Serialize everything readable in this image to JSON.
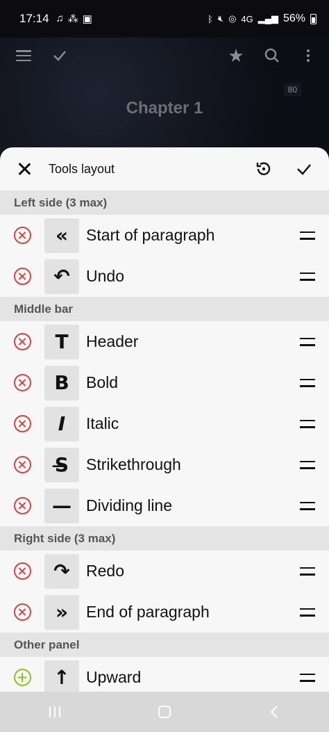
{
  "status_bar": {
    "time": "17:14",
    "network": "4G",
    "battery": "56%"
  },
  "app": {
    "counter": "80",
    "chapter_title": "Chapter 1"
  },
  "sheet": {
    "title": "Tools layout",
    "sections": [
      {
        "label": "Left side (3 max)",
        "items": [
          {
            "label": "Start of paragraph",
            "icon": "double-chevron-left-icon",
            "glyph": "«",
            "state": "remove"
          },
          {
            "label": "Undo",
            "icon": "undo-icon",
            "glyph": "↶",
            "state": "remove"
          }
        ]
      },
      {
        "label": "Middle bar",
        "items": [
          {
            "label": "Header",
            "icon": "header-icon",
            "glyph": "T",
            "state": "remove"
          },
          {
            "label": "Bold",
            "icon": "bold-icon",
            "glyph": "B",
            "state": "remove"
          },
          {
            "label": "Italic",
            "icon": "italic-icon",
            "glyph": "I",
            "state": "remove"
          },
          {
            "label": "Strikethrough",
            "icon": "strikethrough-icon",
            "glyph": "S̶",
            "state": "remove"
          },
          {
            "label": "Dividing line",
            "icon": "dividing-line-icon",
            "glyph": "—",
            "state": "remove"
          }
        ]
      },
      {
        "label": "Right side (3 max)",
        "items": [
          {
            "label": "Redo",
            "icon": "redo-icon",
            "glyph": "↷",
            "state": "remove"
          },
          {
            "label": "End of paragraph",
            "icon": "double-chevron-right-icon",
            "glyph": "»",
            "state": "remove"
          }
        ]
      },
      {
        "label": "Other panel",
        "items": [
          {
            "label": "Upward",
            "icon": "arrow-up-icon",
            "glyph": "↑",
            "state": "add"
          }
        ]
      }
    ]
  },
  "colors": {
    "remove": "#d94040",
    "add": "#8cc21f",
    "section_bg": "#e4e4e4",
    "sheet_bg": "#f7f7f7"
  }
}
